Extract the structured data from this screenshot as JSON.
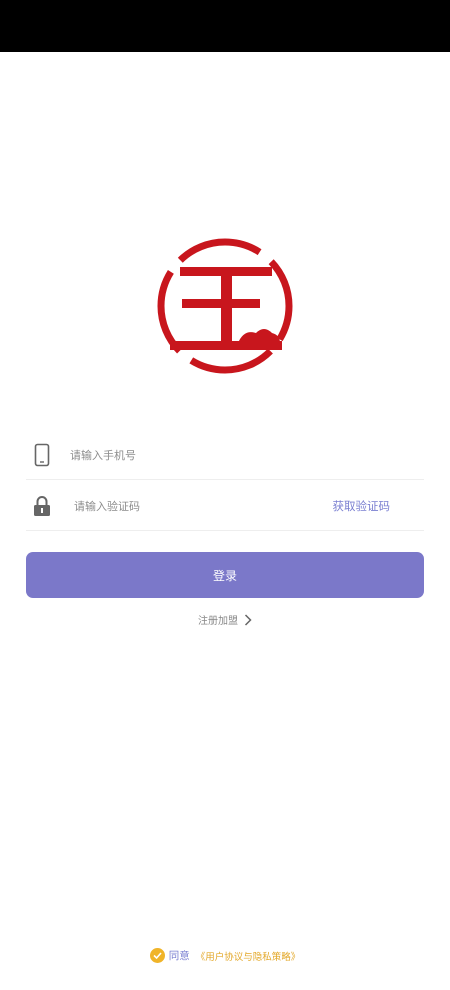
{
  "login": {
    "phone_placeholder": "请输入手机号",
    "code_placeholder": "请输入验证码",
    "get_code_label": "获取验证码",
    "login_label": "登录",
    "register_label": "注册加盟"
  },
  "agreement": {
    "agree_label": "同意",
    "policy_label": "《用户协议与隐私策略》"
  },
  "icons": {
    "phone": "phone-icon",
    "lock": "lock-icon",
    "chevron": "chevron-right-icon",
    "check": "check-circle-icon"
  },
  "colors": {
    "brand_red": "#c8161d",
    "primary": "#7b78c9",
    "link": "#7a7fd1",
    "accent": "#e3a82a"
  }
}
